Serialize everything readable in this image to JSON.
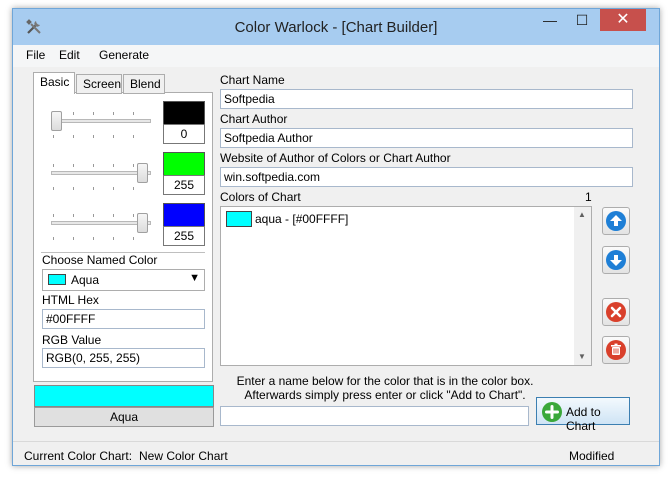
{
  "window": {
    "title": "Color Warlock - [Chart Builder]",
    "controls": {
      "minimize": "—",
      "maximize": "☐",
      "close": "✕"
    }
  },
  "menu": [
    "File",
    "Edit",
    "Generate"
  ],
  "tabs": {
    "items": [
      "Basic",
      "Screen",
      "Blend"
    ],
    "active": "Basic"
  },
  "rgb_channels": [
    {
      "value": "0",
      "level": 0,
      "swatch_color": "#000000"
    },
    {
      "value": "255",
      "level": 1,
      "swatch_color": "#00ff00"
    },
    {
      "value": "255",
      "level": 1,
      "swatch_color": "#0000ff"
    }
  ],
  "named_color": {
    "label": "Choose Named Color",
    "selected": "Aqua",
    "swatch_color": "#00ffff"
  },
  "html_hex": {
    "label": "HTML Hex",
    "value": "#00FFFF"
  },
  "rgb_value": {
    "label": "RGB Value",
    "value": "RGB(0, 255, 255)"
  },
  "preview": {
    "color": "#00ffff",
    "name": "Aqua"
  },
  "chart_name": {
    "label": "Chart Name",
    "value": "Softpedia"
  },
  "chart_author": {
    "label": "Chart Author",
    "value": "Softpedia Author"
  },
  "website": {
    "label": "Website of Author of Colors or Chart Author",
    "value": "win.softpedia.com"
  },
  "colors_of_chart": {
    "label": "Colors of Chart",
    "count": "1",
    "items": [
      {
        "text": "aqua - [#00FFFF]",
        "color": "#00ffff"
      }
    ]
  },
  "hint": {
    "line1": "Enter a name below for the color that is in the color box.",
    "line2": "Afterwards simply press enter or click \"Add to Chart\"."
  },
  "color_name_input": {
    "value": ""
  },
  "add_button": {
    "label": "Add to Chart"
  },
  "status": {
    "current_chart_label": "Current Color Chart:",
    "current_chart_value": "New Color Chart",
    "state": "Modified"
  },
  "colors": {
    "titlebar": "#a7ccf0",
    "close_button": "#c7504c",
    "arrow_buttons": "#1e7fd6",
    "delete_buttons": "#d9402b",
    "add_icon": "#3aa83a"
  },
  "icons": {
    "app": "tools-icon",
    "move_up": "arrow-up-icon",
    "move_down": "arrow-down-icon",
    "remove": "close-circle-icon",
    "delete": "trash-icon",
    "add": "plus-circle-icon"
  }
}
